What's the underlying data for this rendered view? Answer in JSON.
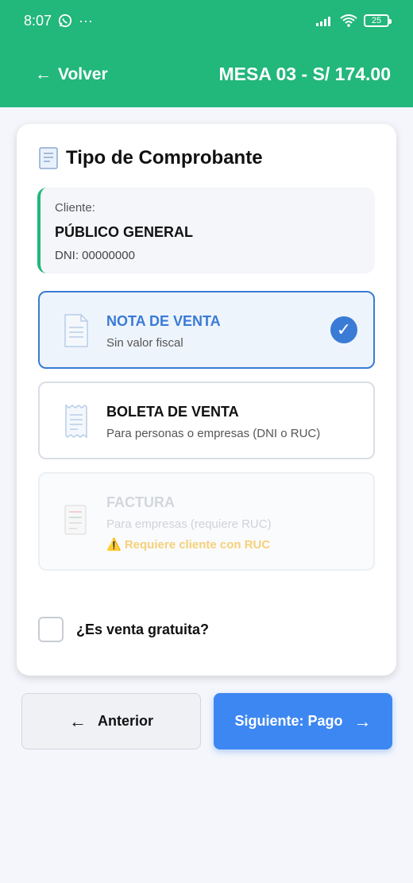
{
  "status_bar": {
    "time": "8:07",
    "extra": "···",
    "battery": "25"
  },
  "header": {
    "back_label": "Volver",
    "title": "MESA 03 - S/ 174.00"
  },
  "card": {
    "title": "Tipo de Comprobante",
    "client": {
      "label": "Cliente:",
      "name": "PÚBLICO GENERAL",
      "dni": "DNI: 00000000"
    },
    "options": [
      {
        "title": "NOTA DE VENTA",
        "subtitle": "Sin valor fiscal",
        "state": "selected"
      },
      {
        "title": "BOLETA DE VENTA",
        "subtitle": "Para personas o empresas (DNI o RUC)",
        "state": "enabled"
      },
      {
        "title": "FACTURA",
        "subtitle": "Para empresas (requiere RUC)",
        "warning": "⚠️ Requiere cliente con RUC",
        "state": "disabled"
      }
    ],
    "free_sale_label": "¿Es venta gratuita?",
    "free_sale_checked": false
  },
  "actions": {
    "prev_label": "Anterior",
    "next_label": "Siguiente: Pago"
  },
  "colors": {
    "brand_green": "#22b77b",
    "accent_blue": "#3a7bd5",
    "button_blue": "#3d87f2"
  }
}
